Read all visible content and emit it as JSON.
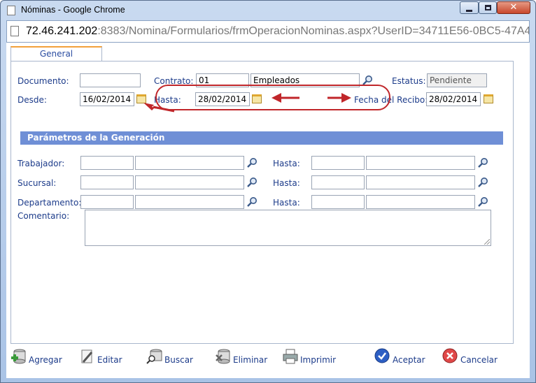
{
  "window": {
    "title": "Nóminas - Google Chrome",
    "url_host": "72.46.241.202",
    "url_path": ":8383/Nomina/Formularios/frmOperacionNominas.aspx?UserID=34711E56-0BC5-47A4-..."
  },
  "tab": {
    "label": "General"
  },
  "form": {
    "documento_label": "Documento:",
    "documento_value": "",
    "contrato_label": "Contrato:",
    "contrato_code": "01",
    "contrato_name": "Empleados",
    "estatus_label": "Estatus:",
    "estatus_value": "Pendiente",
    "desde_label": "Desde:",
    "desde_value": "16/02/2014",
    "hasta_label": "Hasta:",
    "hasta_value": "28/02/2014",
    "fecha_recibo_label": "Fecha del Recibo:",
    "fecha_recibo_value": "28/02/2014"
  },
  "section": {
    "title": "Parámetros de la Generación"
  },
  "params": {
    "trabajador_label": "Trabajador:",
    "sucursal_label": "Sucursal:",
    "departamento_label": "Departamento:",
    "hasta_label": "Hasta:",
    "comentario_label": "Comentario:"
  },
  "toolbar": {
    "agregar": "Agregar",
    "editar": "Editar",
    "buscar": "Buscar",
    "eliminar": "Eliminar",
    "imprimir": "Imprimir",
    "aceptar": "Aceptar",
    "cancelar": "Cancelar"
  },
  "colors": {
    "label": "#1c3b8a",
    "section_header": "#6f8fd6",
    "annotation_red": "#c0262a",
    "tab_accent": "#f2a03a"
  }
}
